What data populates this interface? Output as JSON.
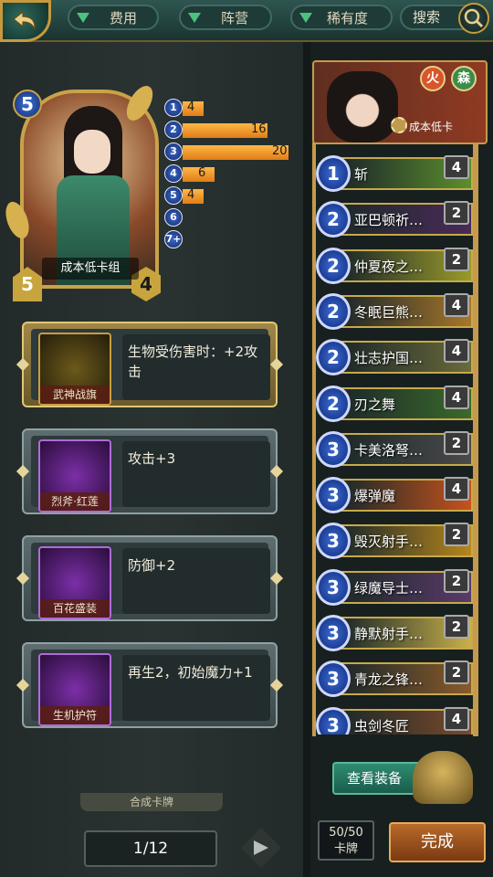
{
  "filters": [
    {
      "label": "费用"
    },
    {
      "label": "阵营"
    },
    {
      "label": "稀有度"
    }
  ],
  "search_label": "搜索",
  "deck": {
    "name": "成本低卡组",
    "cost": "5",
    "attack": "5",
    "health": "4"
  },
  "mana_curve": [
    {
      "cost": "1",
      "count": "4",
      "value": 4
    },
    {
      "cost": "2",
      "count": "16",
      "value": 16
    },
    {
      "cost": "3",
      "count": "20",
      "value": 20
    },
    {
      "cost": "4",
      "count": "6",
      "value": 6
    },
    {
      "cost": "5",
      "count": "4",
      "value": 4
    },
    {
      "cost": "6",
      "count": "",
      "value": 0
    },
    {
      "cost": "7+",
      "count": "",
      "value": 0
    }
  ],
  "equipment": [
    {
      "name": "武神战旗",
      "desc": "生物受伤害时：+2攻击",
      "style": "gold"
    },
    {
      "name": "烈斧·红莲",
      "desc": "攻击+3",
      "style": "silver"
    },
    {
      "name": "百花盛装",
      "desc": "防御+2",
      "style": "silver"
    },
    {
      "name": "生机护符",
      "desc": "再生2，初始魔力+1",
      "style": "silver"
    }
  ],
  "synth_label": "合成卡牌",
  "page": "1/12",
  "banner": {
    "elements": [
      "火",
      "森"
    ],
    "label": "成本低卡"
  },
  "cards": [
    {
      "cost": "1",
      "name": "斩",
      "count": "4",
      "color": "#5b8f2d"
    },
    {
      "cost": "2",
      "name": "亚巴顿祈…",
      "count": "2",
      "color": "#4a2a5a"
    },
    {
      "cost": "2",
      "name": "仲夏夜之…",
      "count": "2",
      "color": "#9a9a2a"
    },
    {
      "cost": "2",
      "name": "冬眠巨熊…",
      "count": "4",
      "color": "#a8762a"
    },
    {
      "cost": "2",
      "name": "壮志护国…",
      "count": "4",
      "color": "#6a6a3a"
    },
    {
      "cost": "2",
      "name": "刃之舞",
      "count": "4",
      "color": "#3a6a2a"
    },
    {
      "cost": "3",
      "name": "卡美洛弩…",
      "count": "2",
      "color": "#4a4a4a"
    },
    {
      "cost": "3",
      "name": "爆弹魔",
      "count": "4",
      "color": "#c7521c"
    },
    {
      "cost": "3",
      "name": "毁灭射手…",
      "count": "2",
      "color": "#b8861c"
    },
    {
      "cost": "3",
      "name": "绿魔导士…",
      "count": "2",
      "color": "#5a3a6a"
    },
    {
      "cost": "3",
      "name": "静默射手…",
      "count": "2",
      "color": "#c9b04a"
    },
    {
      "cost": "3",
      "name": "青龙之锋…",
      "count": "2",
      "color": "#8a5a2a"
    },
    {
      "cost": "3",
      "name": "虫剑冬匠",
      "count": "4",
      "color": "#7a4a2a"
    }
  ],
  "view_equipment_label": "查看装备",
  "deck_count": {
    "value": "50/50",
    "label": "卡牌"
  },
  "done_label": "完成"
}
